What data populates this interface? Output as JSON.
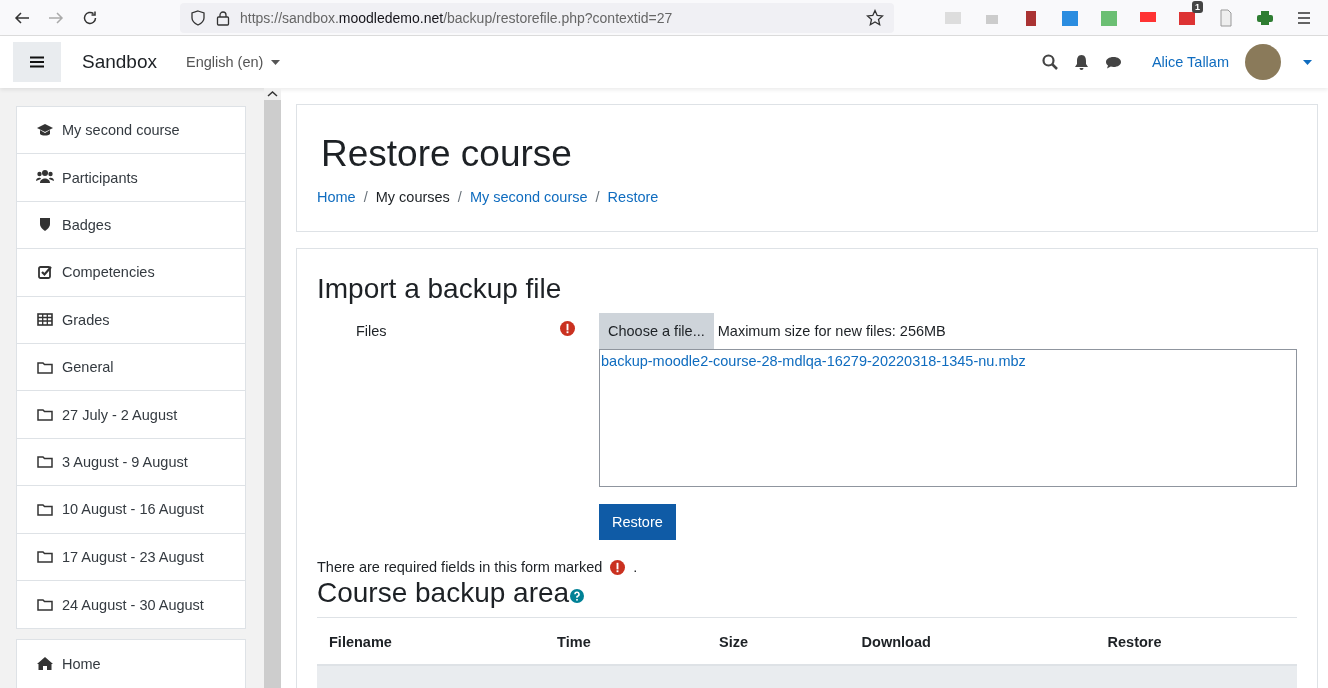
{
  "browser": {
    "url": "https://sandbox.**moodledemo.net**/backup/restorefile.php?contextid=27",
    "extension_badge": "1"
  },
  "navbar": {
    "site_name": "Sandbox",
    "language": "English (en)",
    "user_name": "Alice Tallam"
  },
  "sidebar": {
    "groups": [
      [
        {
          "label": "My second course",
          "kind": "course"
        },
        {
          "label": "Participants",
          "kind": "users"
        },
        {
          "label": "Badges",
          "kind": "shield"
        },
        {
          "label": "Competencies",
          "kind": "check"
        },
        {
          "label": "Grades",
          "kind": "table"
        },
        {
          "label": "General",
          "kind": "folder"
        },
        {
          "label": "27 July - 2 August",
          "kind": "folder"
        },
        {
          "label": "3 August - 9 August",
          "kind": "folder"
        },
        {
          "label": "10 August - 16 August",
          "kind": "folder"
        },
        {
          "label": "17 August - 23 August",
          "kind": "folder"
        },
        {
          "label": "24 August - 30 August",
          "kind": "folder"
        }
      ],
      [
        {
          "label": "Home",
          "kind": "home"
        }
      ]
    ]
  },
  "header": {
    "title": "Restore course",
    "breadcrumb": [
      {
        "label": "Home",
        "kind": "link"
      },
      {
        "label": "/",
        "kind": "separator"
      },
      {
        "label": "My courses",
        "kind": "text"
      },
      {
        "label": "/",
        "kind": "separator"
      },
      {
        "label": "My second course",
        "kind": "link"
      },
      {
        "label": "/",
        "kind": "separator"
      },
      {
        "label": "Restore",
        "kind": "link"
      }
    ]
  },
  "import": {
    "title": "Import a backup file",
    "files_label": "Files",
    "choose_button": "Choose a file...",
    "max_size": "Maximum size for new files: 256MB",
    "file": "backup-moodle2-course-28-mdlqa-16279-20220318-1345-nu.mbz",
    "restore_button": "Restore",
    "required_note": "There are required fields in this form marked",
    "required_note_end": "."
  },
  "backup_area": {
    "title": "Course backup area",
    "columns": [
      "Filename",
      "Time",
      "Size",
      "Download",
      "Restore"
    ]
  }
}
